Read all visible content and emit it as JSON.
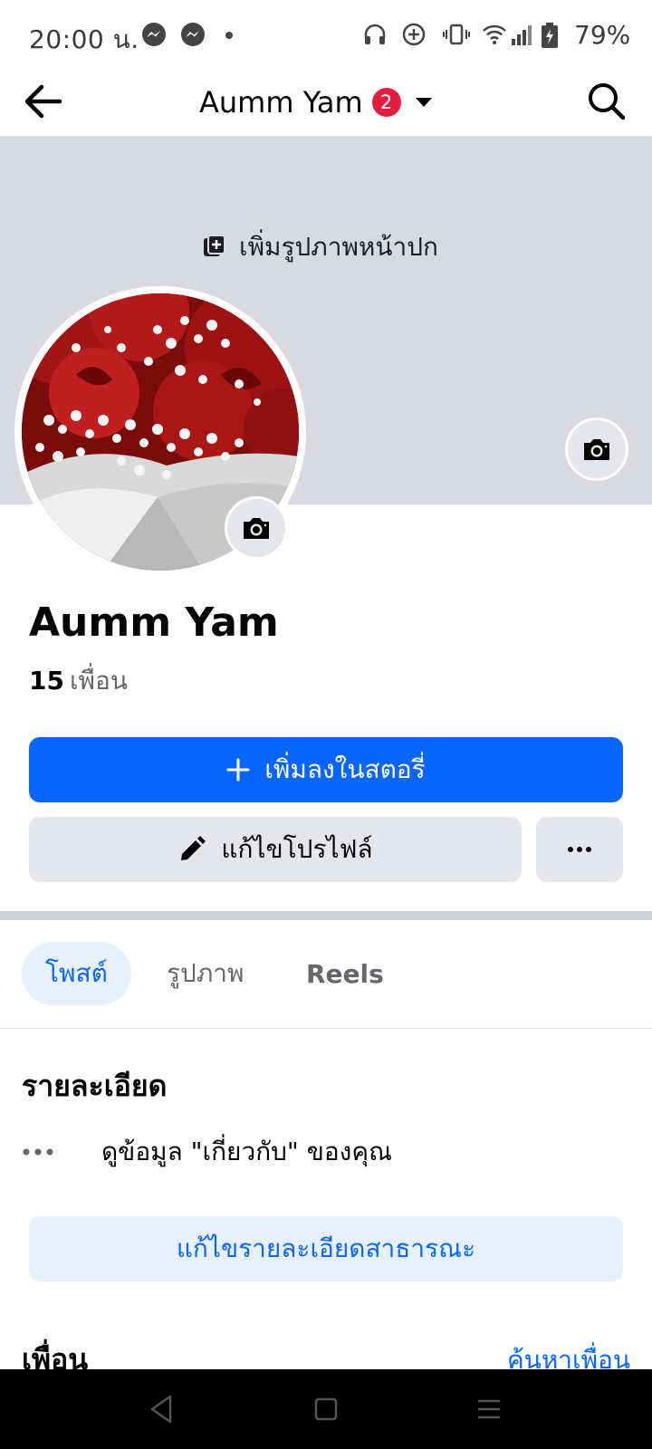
{
  "status_bar": {
    "time": "20:00 น.",
    "battery": "79%",
    "icons": [
      "messenger-icon",
      "messenger-icon",
      "dot-icon",
      "headphones-icon",
      "data-saver-icon",
      "vibrate-icon",
      "wifi-icon",
      "signal-icon",
      "battery-charging-icon"
    ]
  },
  "header": {
    "title": "Aumm Yam",
    "badge": "2",
    "icons": [
      "back-arrow-icon",
      "caret-down-icon",
      "search-icon"
    ]
  },
  "cover": {
    "add_cover_label": "เพิ่มรูปภาพหน้าปก",
    "icons": [
      "add-photo-icon",
      "camera-icon"
    ]
  },
  "profile": {
    "name": "Aumm Yam",
    "friends_count": "15",
    "friends_label": "เพื่อน"
  },
  "actions": {
    "add_story_label": "เพิ่มลงในสตอรี่",
    "edit_profile_label": "แก้ไขโปรไฟล์",
    "icons": [
      "plus-icon",
      "pencil-icon",
      "more-icon"
    ]
  },
  "tabs": [
    {
      "label": "โพสต์",
      "active": true
    },
    {
      "label": "รูปภาพ",
      "active": false
    },
    {
      "label": "Reels",
      "active": false
    }
  ],
  "details": {
    "heading": "รายละเอียด",
    "about_text": "ดูข้อมูล \"เกี่ยวกับ\" ของคุณ",
    "edit_details_label": "แก้ไขรายละเอียดสาธารณะ"
  },
  "friends_section": {
    "heading": "เพื่อน",
    "find_friends_label": "ค้นหาเพื่อน"
  },
  "colors": {
    "accent": "#0866ff",
    "accent_light": "#e7f0fd",
    "badge": "#e41e3f",
    "cover_bg": "#d8dadf",
    "button_gray": "#e4e6eb"
  },
  "nav_bar": {
    "icons": [
      "back-triangle-icon",
      "home-square-icon",
      "recents-menu-icon"
    ]
  }
}
